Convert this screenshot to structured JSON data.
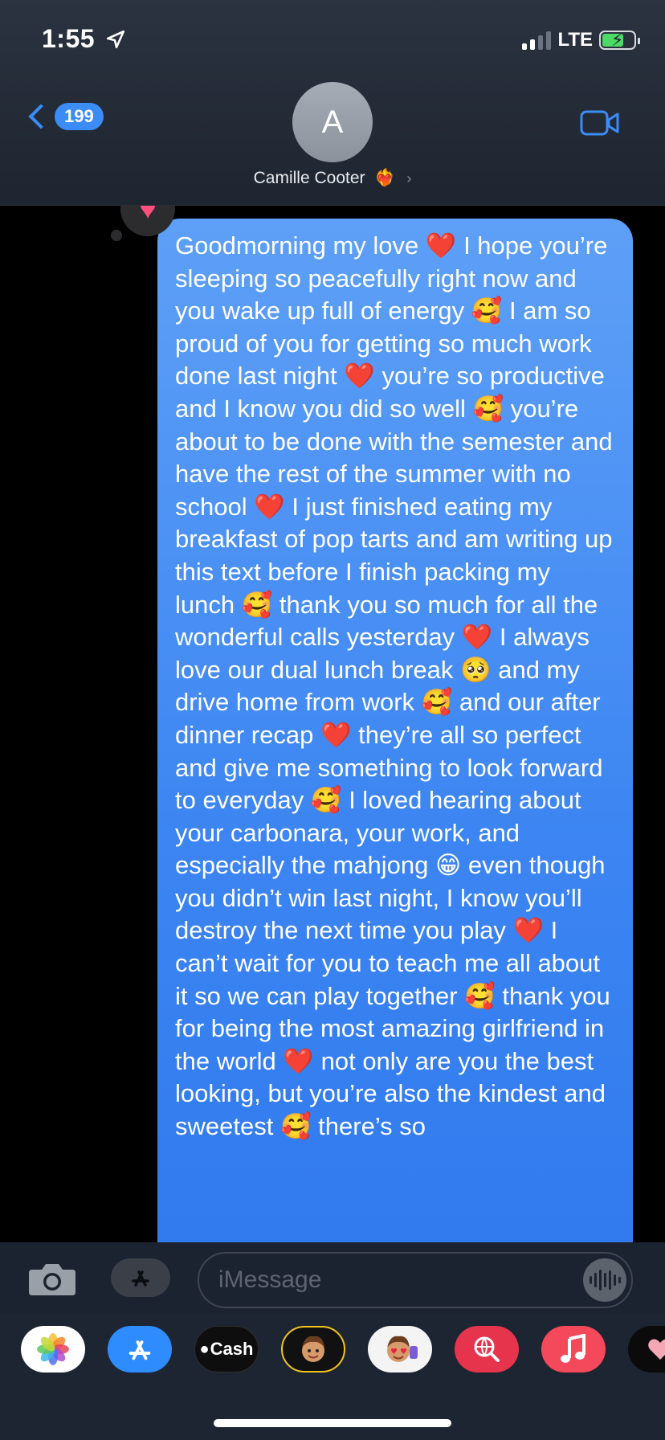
{
  "status_bar": {
    "time": "1:55",
    "location_icon": "location-arrow-icon",
    "network": "LTE",
    "signal_bars_filled": 2,
    "signal_bars_total": 4,
    "battery_charging": true
  },
  "nav": {
    "back_count": "199",
    "avatar_initial": "A",
    "contact_name": "Camille Cooter",
    "contact_emoji": "❤️‍🔥",
    "video_icon": "video-camera-icon"
  },
  "conversation": {
    "tapback_reaction": "heart",
    "message_text": "Goodmorning my love ❤️ I hope you’re sleeping so peacefully right now and you wake up full of energy 🥰 I am so proud of you for getting so much work done last night ❤️ you’re so productive and I know you did so well 🥰 you’re about to be done with the semester and have the rest of the summer with no school ❤️ I just finished eating my breakfast of pop tarts and am writing up this text before I finish packing my lunch 🥰 thank you so much for all the wonderful calls yesterday ❤️ I always love our dual lunch break 🥺 and my drive home from work 🥰 and our after dinner recap ❤️ they’re all so perfect and give me something to look forward to everyday 🥰 I loved hearing about your carbonara, your work, and especially the mahjong 😁 even though you didn’t win last night, I know you’ll destroy the next time you play ❤️ I can’t wait for you to teach me all about it so we can play together 🥰 thank you for being the most amazing girlfriend in the world ❤️ not only are you the best looking, but you’re also the kindest and sweetest 🥰 there’s so"
  },
  "input_bar": {
    "placeholder": "iMessage",
    "camera_icon": "camera-icon",
    "apps_icon": "app-store-icon",
    "audio_icon": "audio-waveform-icon"
  },
  "app_drawer": {
    "apps": [
      "Photos",
      "App Store",
      "Cash",
      "Memoji",
      "Memoji Stickers",
      "Search",
      "Music",
      "More"
    ],
    "cash_label": "Cash"
  },
  "colors": {
    "bubble_top": "#5ea0f7",
    "bubble_bottom": "#2f78ee",
    "accent": "#3b8cf5"
  }
}
